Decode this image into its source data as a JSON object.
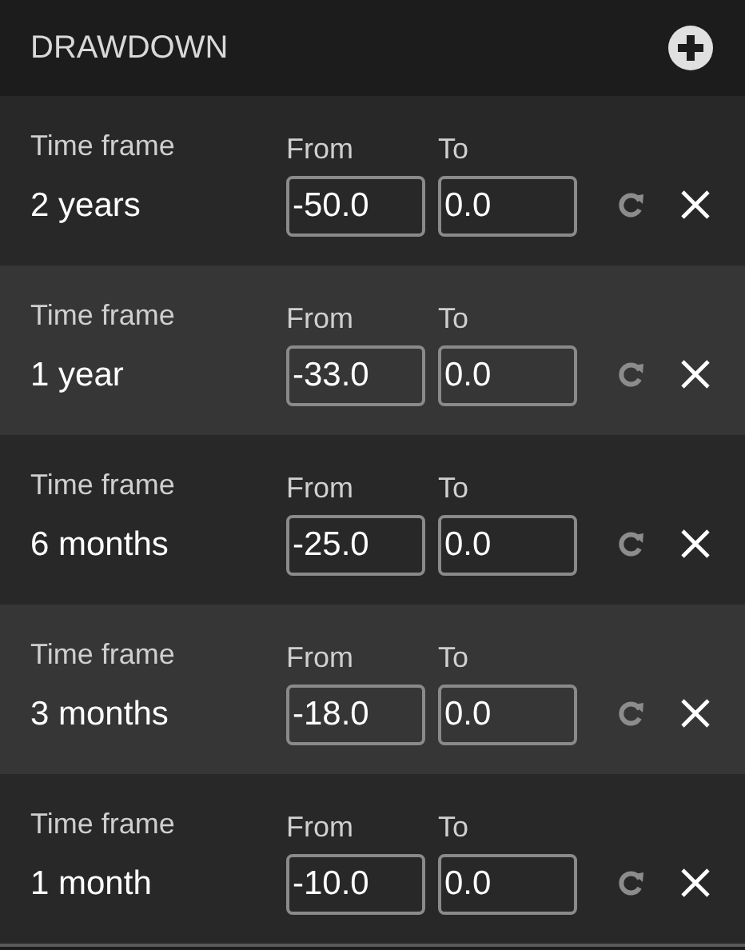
{
  "panel": {
    "title": "DRAWDOWN"
  },
  "rows": [
    {
      "label": "Time frame",
      "value": "2 years",
      "from_label": "From",
      "from": "-50.0",
      "to_label": "To",
      "to": "0.0"
    },
    {
      "label": "Time frame",
      "value": "1 year",
      "from_label": "From",
      "from": "-33.0",
      "to_label": "To",
      "to": "0.0"
    },
    {
      "label": "Time frame",
      "value": "6 months",
      "from_label": "From",
      "from": "-25.0",
      "to_label": "To",
      "to": "0.0"
    },
    {
      "label": "Time frame",
      "value": "3 months",
      "from_label": "From",
      "from": "-18.0",
      "to_label": "To",
      "to": "0.0"
    },
    {
      "label": "Time frame",
      "value": "1 month",
      "from_label": "From",
      "from": "-10.0",
      "to_label": "To",
      "to": "0.0"
    }
  ]
}
